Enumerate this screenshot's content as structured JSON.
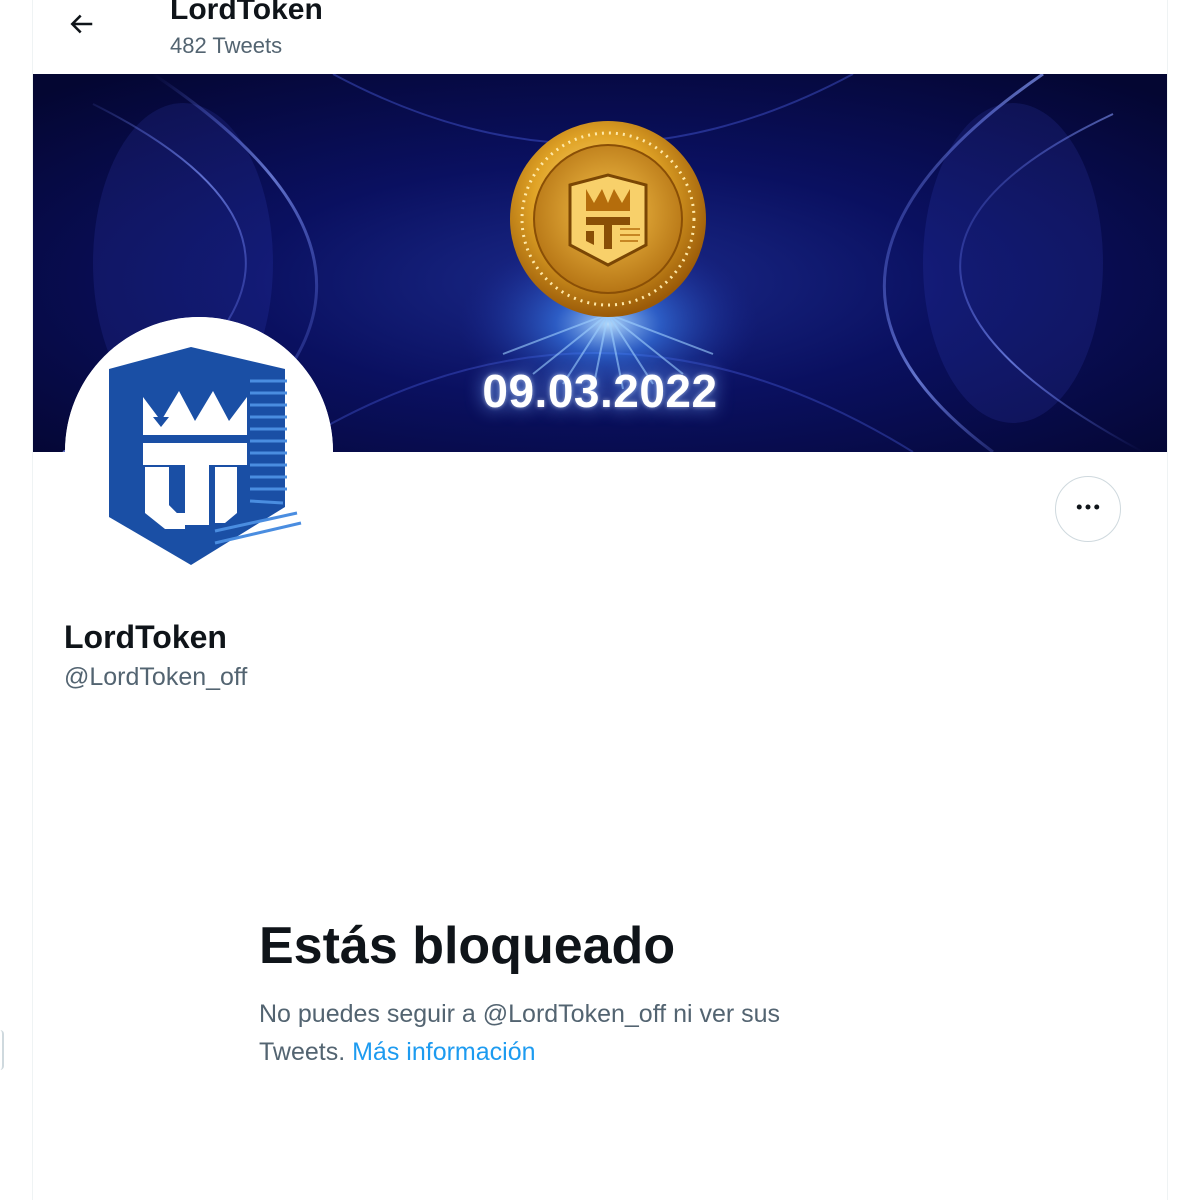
{
  "header": {
    "title": "LordToken",
    "tweet_count": "482 Tweets"
  },
  "banner": {
    "date_text": "09.03.2022"
  },
  "profile": {
    "name": "LordToken",
    "handle": "@LordToken_off"
  },
  "blocked": {
    "title": "Estás bloqueado",
    "message_line1": "No puedes seguir a @LordToken_off ni ver sus",
    "message_line2": "Tweets.",
    "learn_more": "Más información"
  },
  "icons": {
    "back": "arrow-left-icon",
    "more": "more-horizontal-icon"
  },
  "colors": {
    "link": "#1d9bf0",
    "secondary_text": "#536471",
    "primary_text": "#0f1419",
    "logo_blue": "#1a4fa5",
    "banner_bg": "#06093a",
    "coin_gold": "#e0a326"
  }
}
